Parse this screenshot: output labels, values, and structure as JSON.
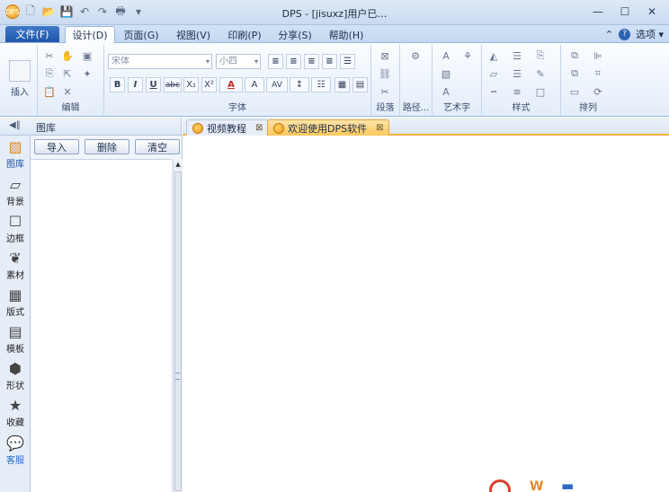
{
  "window": {
    "title": "DPS - [jisuxz]用户已…",
    "minimize_glyph": "—",
    "maximize_glyph": "☐",
    "close_glyph": "✕"
  },
  "menubar": {
    "file_label": "文件(F)",
    "tabs": [
      {
        "label": "设计(D)",
        "active": true
      },
      {
        "label": "页面(G)",
        "active": false
      },
      {
        "label": "视图(V)",
        "active": false
      },
      {
        "label": "印刷(P)",
        "active": false
      },
      {
        "label": "分享(S)",
        "active": false
      },
      {
        "label": "帮助(H)",
        "active": false
      }
    ],
    "options_label": "选项"
  },
  "ribbon": {
    "insert_label": "插入",
    "groups": {
      "edit": "编辑",
      "font": "字体",
      "paragraph": "段落",
      "path": "路径...",
      "art_text": "艺术字",
      "style": "样式",
      "arrange": "排列"
    },
    "font_name": "宋体",
    "font_size": "小四",
    "font_buttons": [
      "B",
      "I",
      "U",
      "abc",
      "X₂",
      "X²",
      "A",
      "A",
      "AV"
    ]
  },
  "left_panel": {
    "title": "图库",
    "collapse_glyph": "◀‖",
    "buttons": {
      "import": "导入",
      "delete": "删除",
      "clear": "清空"
    },
    "nav": [
      {
        "label": "图库",
        "icon": "gallery-icon",
        "active": true
      },
      {
        "label": "背景",
        "icon": "background-icon",
        "active": false
      },
      {
        "label": "边框",
        "icon": "border-icon",
        "active": false
      },
      {
        "label": "素材",
        "icon": "material-icon",
        "active": false
      },
      {
        "label": "版式",
        "icon": "layout-icon",
        "active": false
      },
      {
        "label": "模板",
        "icon": "template-icon",
        "active": false
      },
      {
        "label": "形状",
        "icon": "shape-icon",
        "active": false
      },
      {
        "label": "收藏",
        "icon": "favorite-icon",
        "active": false
      },
      {
        "label": "客服",
        "icon": "support-icon",
        "active": false
      }
    ]
  },
  "doc_tabs": [
    {
      "label": "视频教程",
      "active": false
    },
    {
      "label": "欢迎使用DPS软件",
      "active": true
    }
  ],
  "colors": {
    "accent": "#1e56a8",
    "active_tab": "#fbc85c",
    "ribbon_bg": "#e3edf9"
  }
}
